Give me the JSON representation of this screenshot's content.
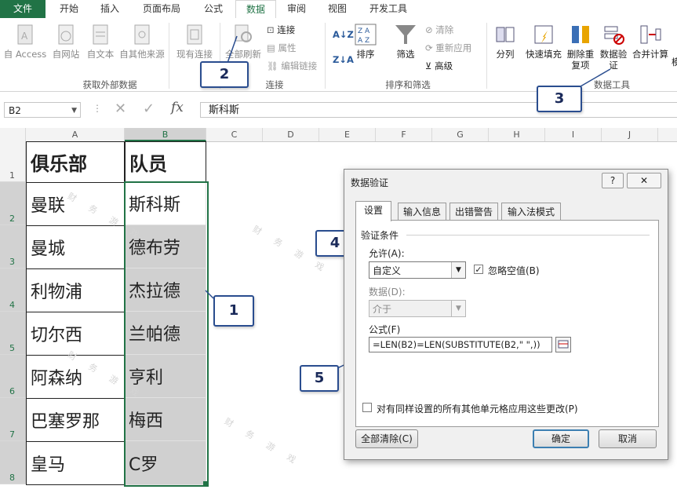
{
  "tabs": [
    "文件",
    "开始",
    "插入",
    "页面布局",
    "公式",
    "数据",
    "审阅",
    "视图",
    "开发工具"
  ],
  "active_tab": "数据",
  "ribbon": {
    "get_external": {
      "label": "获取外部数据",
      "items": [
        "自 Access",
        "自网站",
        "自文本",
        "自其他来源",
        "现有连接"
      ]
    },
    "connections": {
      "label": "连接",
      "refresh": "全部刷新",
      "items": [
        "连接",
        "属性",
        "编辑链接"
      ]
    },
    "sort_filter": {
      "label": "排序和筛选",
      "sort": "排序",
      "filter": "筛选",
      "items": [
        "清除",
        "重新应用",
        "高级"
      ]
    },
    "data_tools": {
      "label": "数据工具",
      "items": [
        "分列",
        "快速填充",
        "删除重复项",
        "数据验证",
        "合并计算"
      ],
      "extra": "模"
    }
  },
  "formula_bar": {
    "name_box": "B2",
    "fx": "fx",
    "value": "斯科斯"
  },
  "columns": [
    "A",
    "B",
    "C",
    "D",
    "E",
    "F",
    "G",
    "H",
    "I",
    "J"
  ],
  "rows": [
    "1",
    "2",
    "3",
    "4",
    "5",
    "6",
    "7",
    "8"
  ],
  "cells": {
    "A": [
      "俱乐部",
      "曼联",
      "曼城",
      "利物浦",
      "切尔西",
      "阿森纳",
      "巴塞罗那",
      "皇马"
    ],
    "B": [
      "队员",
      "斯科斯",
      "德布劳",
      "杰拉德",
      "兰帕德",
      "亨利",
      "梅西",
      "C罗"
    ]
  },
  "callouts": [
    "1",
    "2",
    "3",
    "4",
    "5"
  ],
  "watermark": "财 务 游 戏",
  "dialog": {
    "title": "数据验证",
    "help": "?",
    "close": "✕",
    "tabs": [
      "设置",
      "输入信息",
      "出错警告",
      "输入法模式"
    ],
    "section": "验证条件",
    "allow_label": "允许(A):",
    "allow_value": "自定义",
    "ignore_blank": "忽略空值(B)",
    "data_label": "数据(D):",
    "data_value": "介于",
    "formula_label": "公式(F)",
    "formula_value": "=LEN(B2)=LEN(SUBSTITUTE(B2,\" \",))",
    "apply_all": "对有同样设置的所有其他单元格应用这些更改(P)",
    "clear_all": "全部清除(C)",
    "ok": "确定",
    "cancel": "取消"
  }
}
